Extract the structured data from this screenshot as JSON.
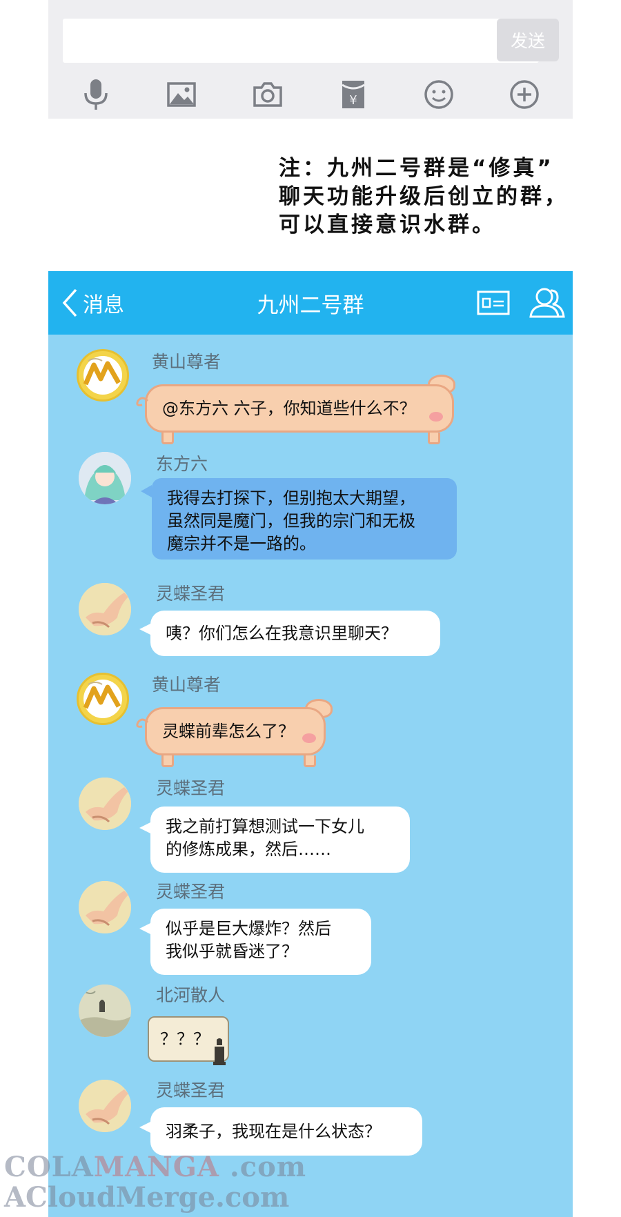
{
  "input_bar": {
    "placeholder": "",
    "send_label": "发送",
    "icons": [
      "microphone-icon",
      "image-icon",
      "camera-icon",
      "red-packet-icon",
      "emoji-icon",
      "plus-icon"
    ]
  },
  "note": {
    "lines": [
      "注：九州二号群是“修真”",
      "聊天功能升级后创立的群，",
      "可以直接意识水群。"
    ]
  },
  "chat": {
    "back_label": "消息",
    "title": "九州二号群",
    "colors": {
      "navbar": "#22b3ef",
      "background": "#8fd4f4",
      "blue_bubble": "#6fb3ef",
      "pig_bubble": "#f8cfae"
    },
    "messages": [
      {
        "sender": "黄山尊者",
        "lines": [
          "@东方六  六子，你知道些什么不？"
        ],
        "style": "pig"
      },
      {
        "sender": "东方六",
        "lines": [
          "我得去打探下，但别抱太大期望，",
          "虽然同是魔门，但我的宗门和无极",
          "魔宗并不是一路的。"
        ],
        "style": "blue"
      },
      {
        "sender": "灵蝶圣君",
        "lines": [
          "咦？你们怎么在我意识里聊天？"
        ],
        "style": "white"
      },
      {
        "sender": "黄山尊者",
        "lines": [
          "灵蝶前辈怎么了？"
        ],
        "style": "pig"
      },
      {
        "sender": "灵蝶圣君",
        "lines": [
          "我之前打算想测试一下女儿",
          "的修炼成果，然后……"
        ],
        "style": "white"
      },
      {
        "sender": "灵蝶圣君",
        "lines": [
          "似乎是巨大爆炸？然后",
          "我似乎就昏迷了？"
        ],
        "style": "white"
      },
      {
        "sender": "北河散人",
        "lines": [
          "？？？"
        ],
        "style": "scroll"
      },
      {
        "sender": "灵蝶圣君",
        "lines": [
          "羽柔子，我现在是什么状态？"
        ],
        "style": "white"
      }
    ]
  },
  "watermark": {
    "line1_a": "COLA",
    "line1_b": "MANGA",
    "line1_c": " .com",
    "line2": "ACloudMerge.com"
  }
}
